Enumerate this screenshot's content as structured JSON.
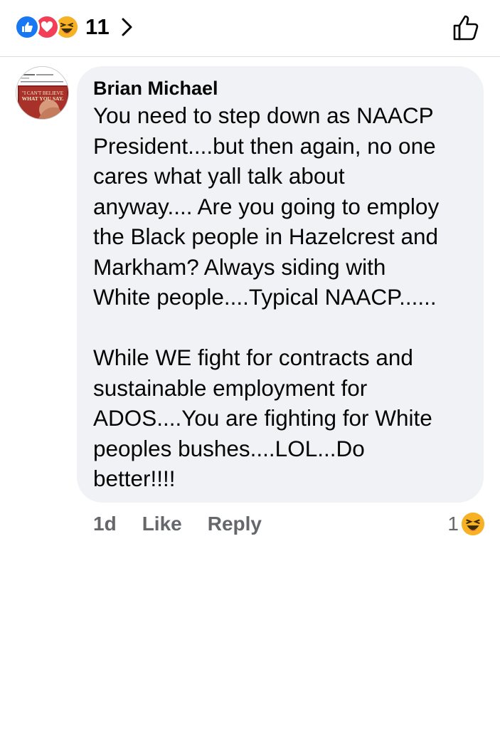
{
  "reactions_bar": {
    "icons": [
      "like-icon",
      "love-icon",
      "haha-icon"
    ],
    "count": "11"
  },
  "colors": {
    "like": "#1877f2",
    "love": "#f33e58",
    "haha": "#f7b125",
    "bubble": "#f0f2f5",
    "meta": "#65676b"
  },
  "comment": {
    "author": "Brian Michael",
    "text": "You need to step down as NAACP\nPresident....but then again, no one\ncares what yall talk about\nanyway.... Are you going to employ\nthe Black people in Hazelcrest and\nMarkham? Always siding with\nWhite people....Typical NAACP......\n\nWhile WE fight for contracts and\nsustainable employment for\nADOS....You are fighting for White\npeoples bushes....LOL...Do\nbetter!!!!",
    "time": "1d",
    "like_label": "Like",
    "reply_label": "Reply",
    "reaction_count": "1",
    "reaction_icon": "haha-icon"
  },
  "avatar": {
    "caption_line1": "\"I CAN'T BELIEVE",
    "caption_line2": "WHAT YOU SAY."
  }
}
